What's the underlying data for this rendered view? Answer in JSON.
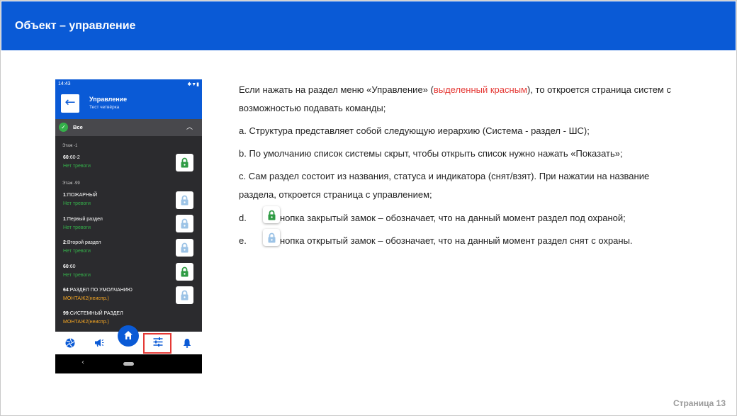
{
  "slide": {
    "title": "Объект – управление",
    "footer": "Страница 13"
  },
  "phone": {
    "status_time": "14:43",
    "status_icons": "✱▼▮",
    "appbar_title": "Управление",
    "appbar_subtitle": "Тест четвёрка",
    "filter_label": "Все",
    "floors": [
      "Этаж -1",
      "Этаж -99"
    ],
    "items": [
      {
        "num": "60",
        "name": ":60-2",
        "status": "Нет тревоги",
        "status_color": "#35b04a",
        "lock": "closed"
      },
      {
        "num": "1",
        "name": ":ПОЖАРНЫЙ",
        "status": "Нет тревоги",
        "status_color": "#35b04a",
        "lock": "open"
      },
      {
        "num": "1",
        "name": ":Первый раздел",
        "status": "Нет тревоги",
        "status_color": "#35b04a",
        "lock": "open"
      },
      {
        "num": "2",
        "name": ":Второй раздел",
        "status": "Нет тревоги",
        "status_color": "#35b04a",
        "lock": "open"
      },
      {
        "num": "60",
        "name": ":60",
        "status": "Нет тревоги",
        "status_color": "#35b04a",
        "lock": "closed"
      },
      {
        "num": "64",
        "name": ":РАЗДЕЛ ПО УМОЛЧАНИЮ",
        "status": "МОНТАЖ2(неиспр.)",
        "status_color": "#f5a623",
        "lock": "open"
      },
      {
        "num": "99",
        "name": ":СИСТЕМНЫЙ РАЗДЕЛ",
        "status": "МОНТАЖ2(неиспр.)",
        "status_color": "#f5a623",
        "lock": "none"
      }
    ],
    "nav": [
      "camera-aperture-icon",
      "megaphone-icon",
      "home-icon",
      "sliders-icon",
      "bell-icon"
    ],
    "active_nav": "sliders-icon"
  },
  "text": {
    "p1_a": "Если нажать на раздел меню «Управление» (",
    "p1_red": "выделенный красным",
    "p1_b": "), то откроется страница систем с",
    "p1_c": "возможностью подавать команды;",
    "a": "a. Структура представляет собой следующую иерархию (Система - раздел - ШС);",
    "b": "b. По умолчанию список системы скрыт, чтобы открыть список нужно нажать «Показать»;",
    "c1": "c. Сам раздел состоит из названия, статуса и индикатора (снят/взят). При нажатии на название",
    "c2": "раздела, откроется страница с управлением;",
    "d_letter": "d.",
    "d_text": "нопка закрытый замок  – обозначает, что на данный момент раздел под охраной;",
    "e_letter": "e.",
    "e_text": "нопка открытый замок  – обозначает, что на данный момент раздел снят с охраны."
  },
  "colors": {
    "brand_blue": "#0a5ad6",
    "ok_green": "#35b04a",
    "warn_orange": "#f5a623",
    "highlight_red": "#e53935",
    "lock_open": "#9cc3e6"
  }
}
